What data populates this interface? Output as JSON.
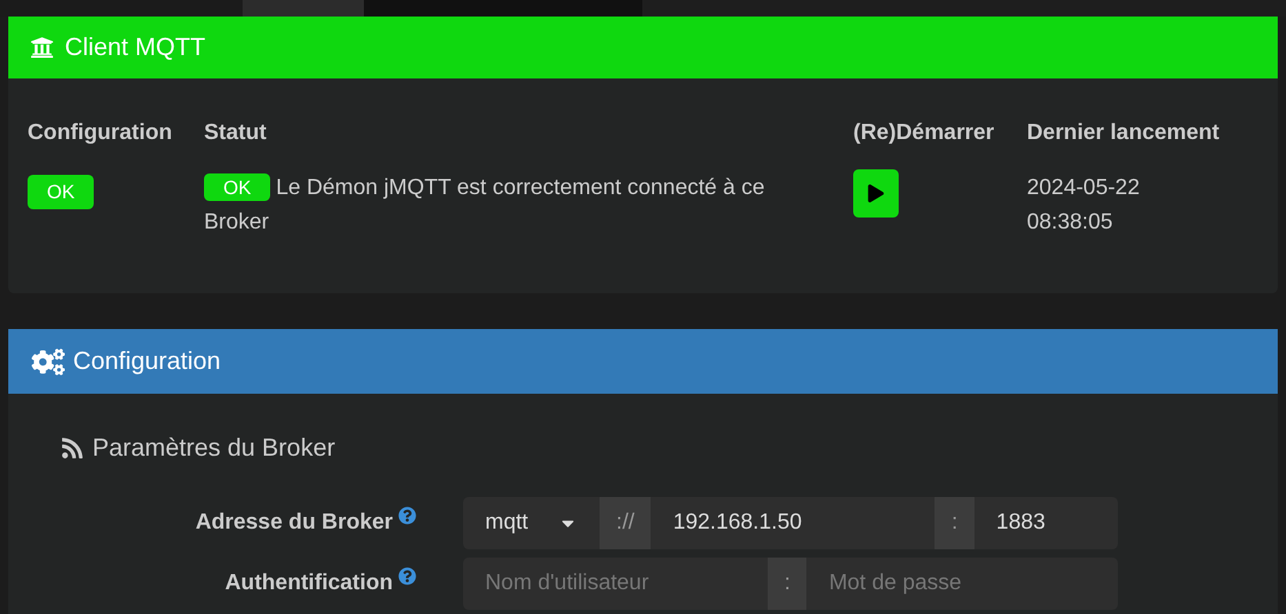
{
  "client_panel": {
    "title": "Client MQTT",
    "table": {
      "columns": [
        "Configuration",
        "Statut",
        "(Re)Démarrer",
        "Dernier lancement"
      ],
      "row": {
        "configuration_badge": "OK",
        "status_badge": "OK",
        "status_text": "Le Démon jMQTT est correctement connecté à ce Broker",
        "last_launch": "2024-05-22 08:38:05"
      }
    }
  },
  "config_panel": {
    "title": "Configuration",
    "section_title": "Paramètres du Broker",
    "fields": [
      {
        "kind": "address",
        "label": "Adresse du Broker",
        "protocol": "mqtt",
        "scheme_separator": "://",
        "host": "192.168.1.50",
        "port_separator": ":",
        "port": "1883"
      },
      {
        "kind": "auth",
        "label": "Authentification",
        "username_placeholder": "Nom d'utilisateur",
        "separator": ":",
        "password_placeholder": "Mot de passe"
      }
    ]
  }
}
